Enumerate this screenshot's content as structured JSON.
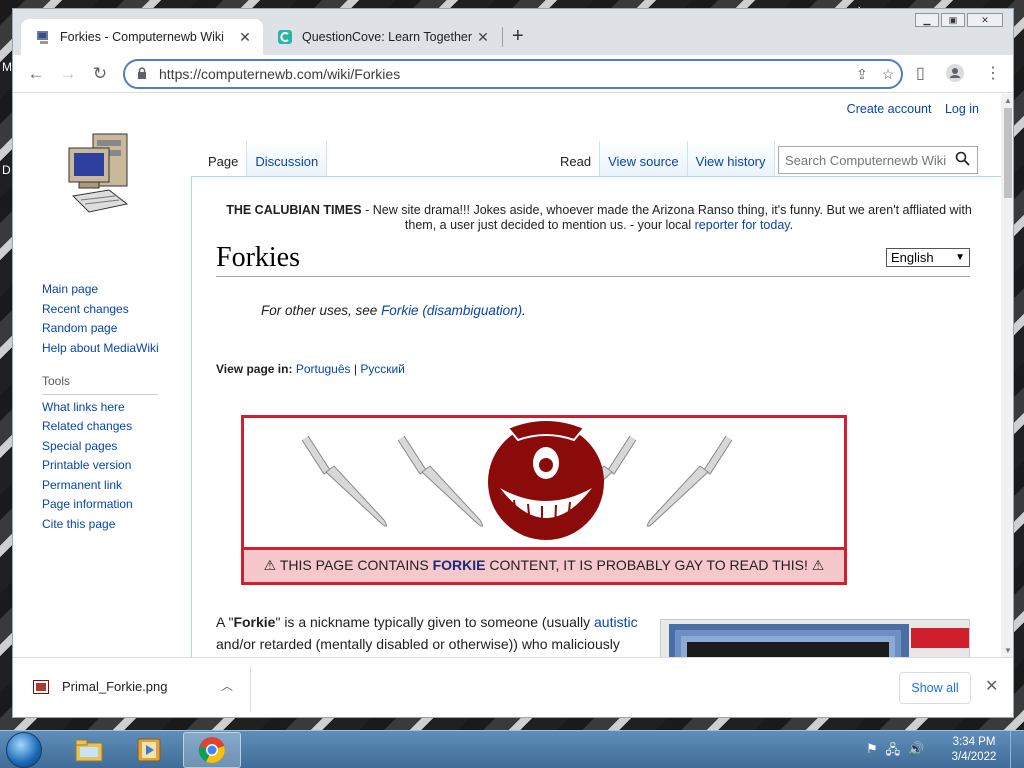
{
  "browser": {
    "tabs": [
      {
        "label": "Forkies - Computernewb Wiki",
        "active": true,
        "close": "✕"
      },
      {
        "label": "QuestionCove: Learn Together",
        "active": false,
        "close": "✕"
      }
    ],
    "new_tab": "+",
    "url": "https://computernewb.com/wiki/Forkies"
  },
  "wiki": {
    "user_links": [
      "Create account",
      "Log in"
    ],
    "nav_tabs_left": [
      "Page",
      "Discussion"
    ],
    "nav_tabs_right": [
      "Read",
      "View source",
      "View history"
    ],
    "search_placeholder": "Search Computernewb Wiki",
    "sitenotice": {
      "bold": "THE CALUBIAN TIMES",
      "text": " - New site drama!!! Jokes aside, whoever made the Arizona Ranso thing, it's funny. But we aren't affliated with them, a user just decided to mention us. - your local ",
      "link": "reporter for today",
      "end": "."
    },
    "title": "Forkies",
    "language": "English",
    "hatnote": {
      "prefix": "For other uses, see ",
      "link": "Forkie (disambiguation)",
      "suffix": "."
    },
    "variants": {
      "label": "View page in:",
      "langs": [
        "Português",
        "Русский"
      ],
      "sep": "|"
    },
    "warning": {
      "prefix": "THIS PAGE CONTAINS ",
      "bold": "FORKIE",
      "suffix": " CONTENT, IT IS PROBABLY GAY TO READ THIS!"
    },
    "body": {
      "p1": "A \"",
      "p1_bold": "Forkie",
      "p1_b": "\" is a nickname typically given to someone (usually ",
      "p1_link": "autistic",
      "p1_c": " and/or retarded (mentally disabled or otherwise)) who maliciously causes destruction or otherwise renders the virtual machines"
    },
    "sidebar": {
      "nav": [
        "Main page",
        "Recent changes",
        "Random page",
        "Help about MediaWiki"
      ],
      "tools_heading": "Tools",
      "tools": [
        "What links here",
        "Related changes",
        "Special pages",
        "Printable version",
        "Permanent link",
        "Page information",
        "Cite this page"
      ]
    }
  },
  "downloads": {
    "filename": "Primal_Forkie.png",
    "show_all": "Show all",
    "close": "✕"
  },
  "taskbar": {
    "time": "3:34 PM",
    "date": "3/4/2022"
  },
  "colors": {
    "link": "#0645ad",
    "warning_border": "#d0202e",
    "warning_fill": "#f7c8cb",
    "omnibox_focus": "#4d7cc8"
  }
}
